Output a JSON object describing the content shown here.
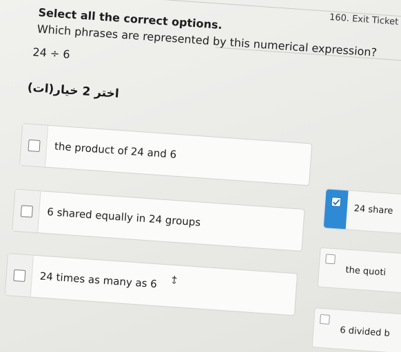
{
  "header": {
    "exit_ticket": "160. Exit Ticket"
  },
  "question": {
    "instruction": "Select all the correct options.",
    "prompt": "Which phrases are represented by this numerical expression?",
    "expression": "24 ÷ 6",
    "arabic_note": "اختر 2 خيار(ات)"
  },
  "options_left": [
    {
      "label": "the product of 24 and 6",
      "checked": false
    },
    {
      "label": "6 shared equally in 24 groups",
      "checked": false
    },
    {
      "label": "24 times as many as 6",
      "checked": false
    }
  ],
  "options_right": [
    {
      "label": "24 share",
      "checked": true
    },
    {
      "label": "the quoti",
      "checked": false
    },
    {
      "label": "6 divided b",
      "checked": false
    }
  ],
  "colors": {
    "accent": "#2f8ad6"
  }
}
